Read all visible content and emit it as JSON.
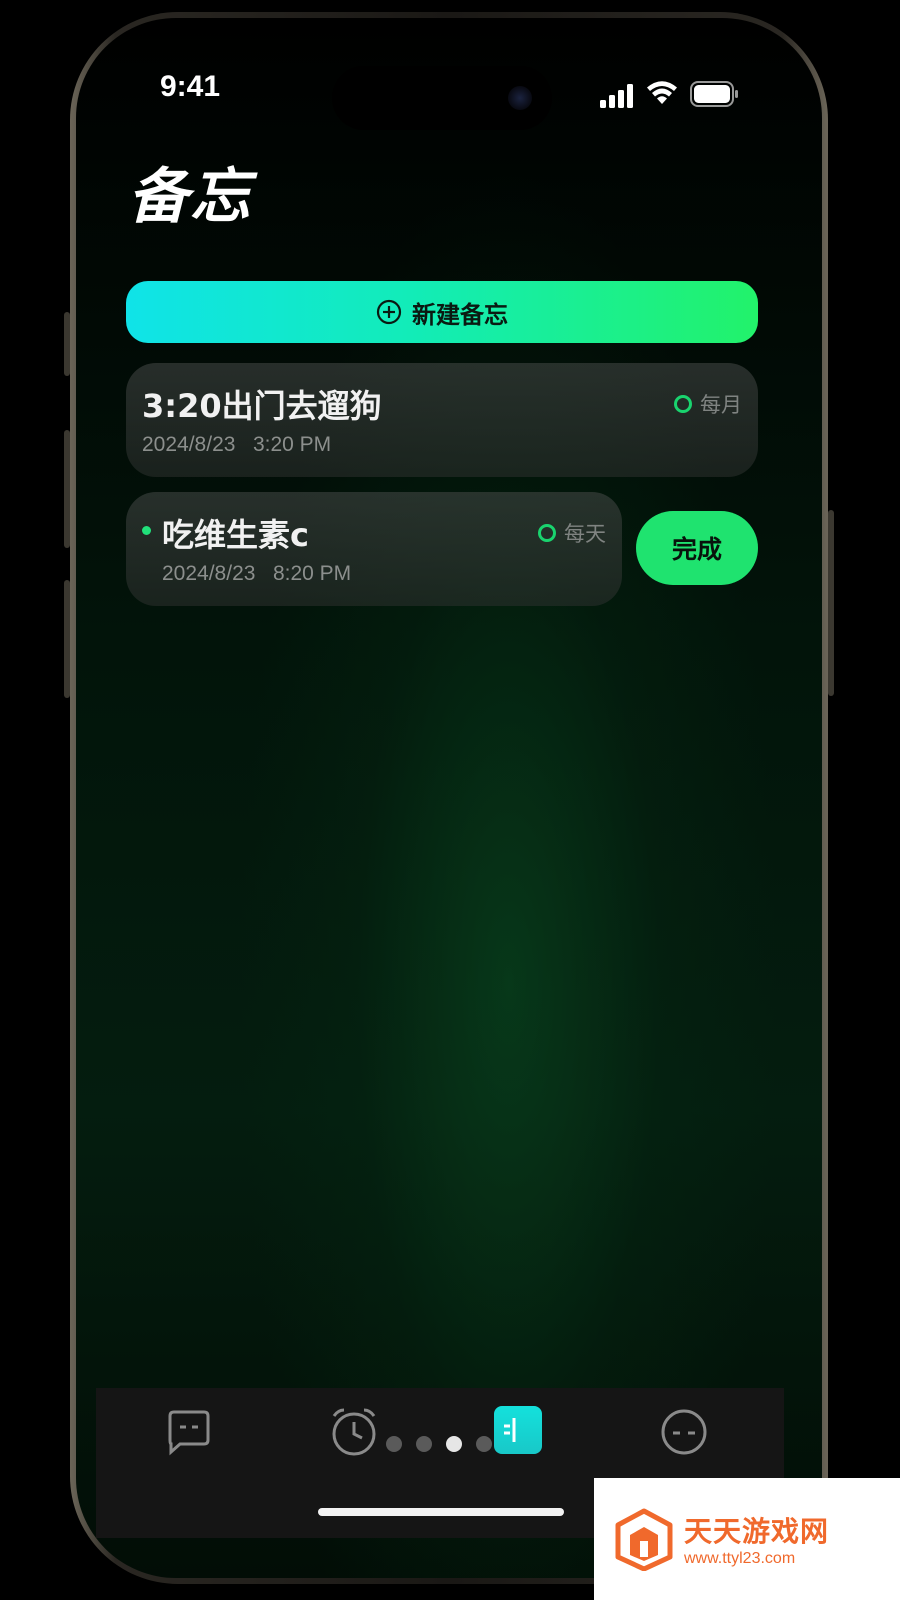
{
  "status_bar": {
    "time": "9:41"
  },
  "header": {
    "title": "备忘"
  },
  "actions": {
    "new_memo_label": "新建备忘"
  },
  "memos": [
    {
      "title": "3:20出门去遛狗",
      "date": "2024/8/23",
      "time": "3:20 PM",
      "repeat": "每月",
      "unread": false
    },
    {
      "title": "吃维生素c",
      "date": "2024/8/23",
      "time": "8:20 PM",
      "repeat": "每天",
      "unread": true,
      "action_label": "完成"
    }
  ],
  "tab_bar": {
    "tabs": [
      {
        "name": "chat",
        "icon": "chat-bubble-icon",
        "active": false
      },
      {
        "name": "alarm",
        "icon": "alarm-clock-icon",
        "active": false
      },
      {
        "name": "memo",
        "icon": "memo-icon",
        "active": true
      },
      {
        "name": "profile",
        "icon": "face-icon",
        "active": false
      }
    ],
    "page_dots": {
      "count": 4,
      "active_index": 2
    }
  },
  "watermark": {
    "title": "天天游戏网",
    "url": "www.ttyl23.com"
  },
  "colors": {
    "accent": "#1fe36f",
    "gradient_start": "#10e3e8",
    "gradient_end": "#22f26a",
    "background": "#000000"
  }
}
